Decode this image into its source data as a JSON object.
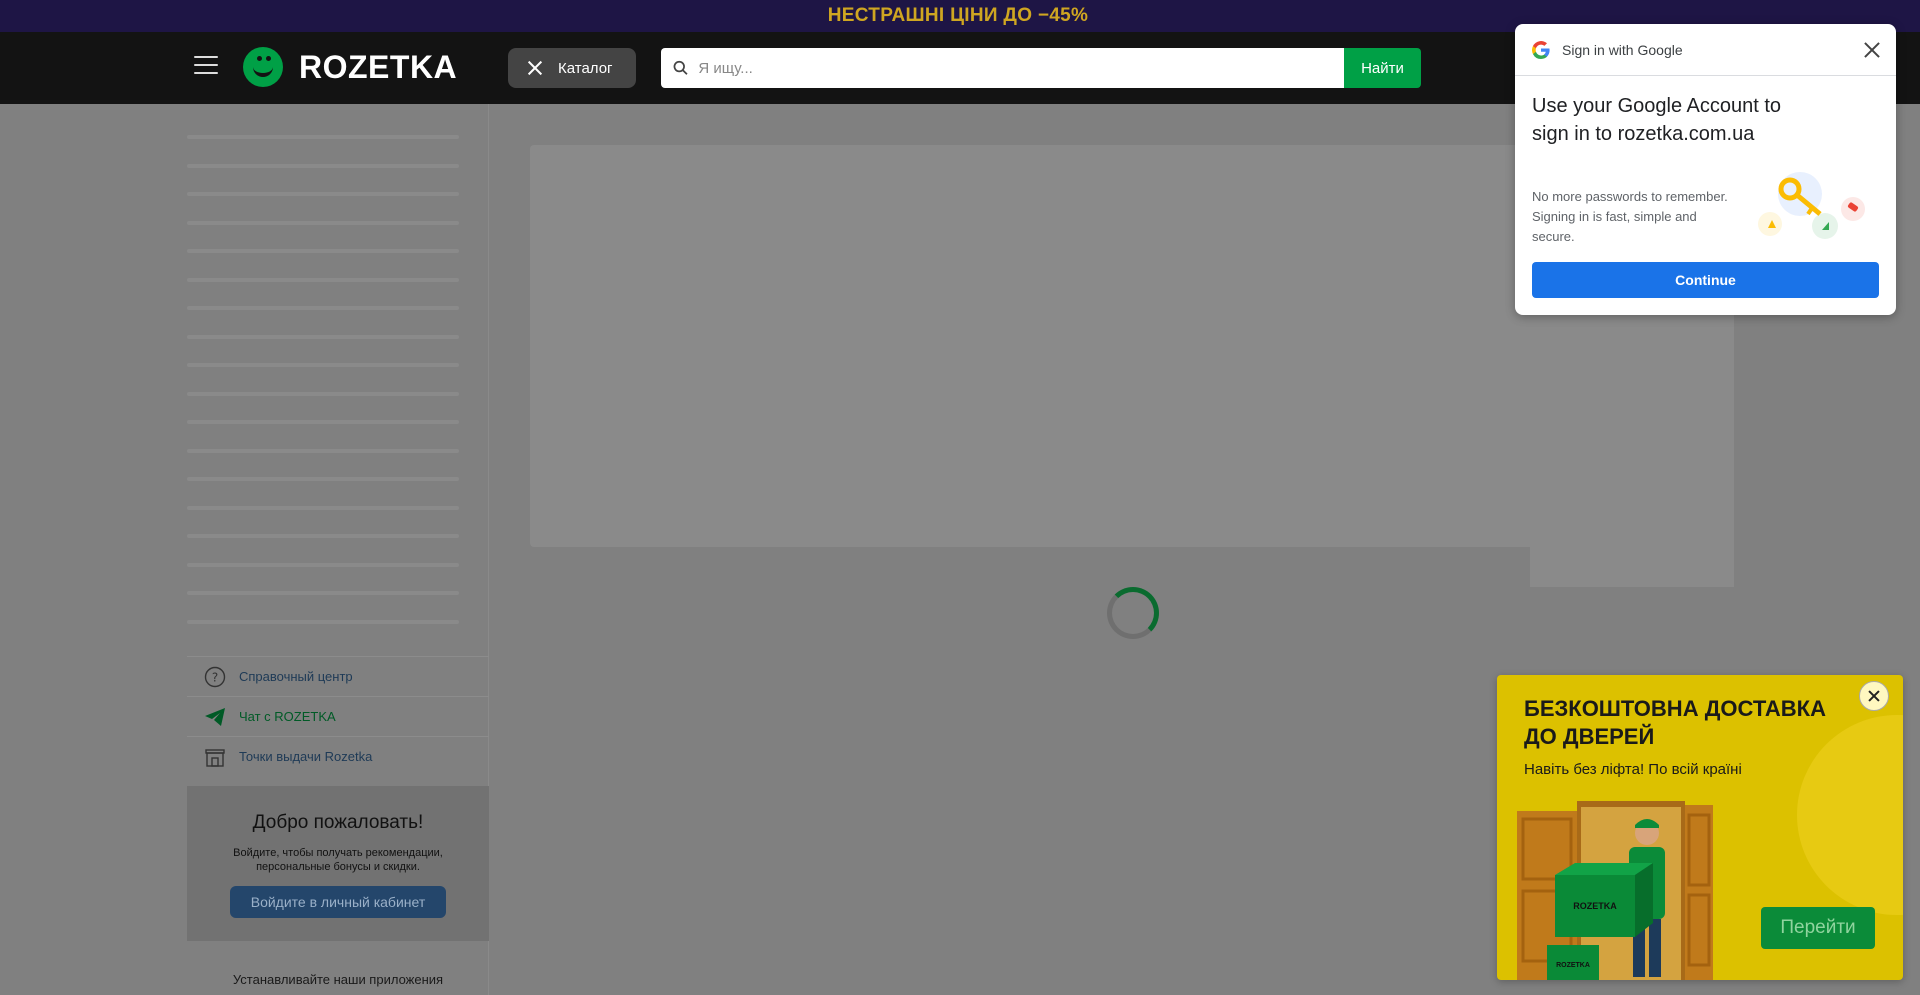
{
  "promo": {
    "text": "НЕСТРАШНІ ЦІНИ ДО −45%"
  },
  "header": {
    "logo_text": "ROZETKA",
    "catalog_label": "Каталог",
    "search_placeholder": "Я ищу...",
    "search_button": "Найти"
  },
  "sidebar": {
    "links": [
      {
        "label": "Справочный центр",
        "icon": "help-circle-icon"
      },
      {
        "label": "Чат с ROZETKA",
        "icon": "telegram-icon"
      },
      {
        "label": "Точки выдачи Rozetka",
        "icon": "store-icon"
      }
    ],
    "welcome": {
      "title": "Добро пожаловать!",
      "text": "Войдите, чтобы получать рекомендации, персональные бонусы и скидки.",
      "button": "Войдите в личный кабинет"
    },
    "apps_label": "Устанавливайте наши приложения"
  },
  "google_popup": {
    "header": "Sign in with Google",
    "heading": "Use your Google Account to sign in to rozetka.com.ua",
    "body": "No more passwords to remember. Signing in is fast, simple and secure.",
    "button": "Continue"
  },
  "ad": {
    "title": "БЕЗКОШТОВНА ДОСТАВКА ДО ДВЕРЕЙ",
    "subtitle": "Навіть без ліфта! По всій країні",
    "button": "Перейти",
    "box_label": "ROZETKA"
  },
  "colors": {
    "brand_green": "#00a046",
    "google_blue": "#1a73e8",
    "promo_bg": "#1e1545",
    "ad_yellow": "#dcc100"
  }
}
